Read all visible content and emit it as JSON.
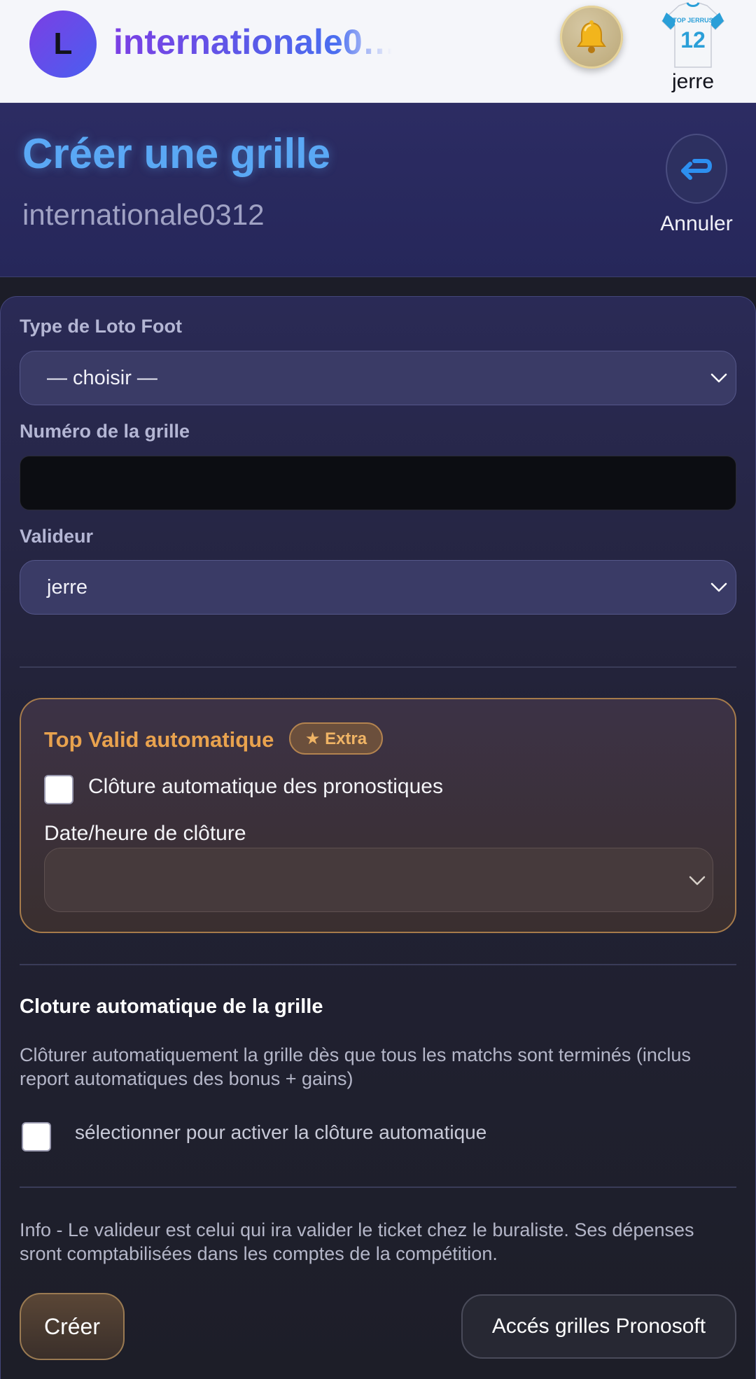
{
  "topbar": {
    "avatar_letter": "L",
    "app_title": "internationale0…",
    "user_name": "jerre",
    "jersey_text": "TOP JERRUS",
    "jersey_number": "12"
  },
  "header": {
    "title": "Créer une grille",
    "subtitle": "internationale0312",
    "cancel_label": "Annuler"
  },
  "form": {
    "type_label": "Type de Loto Foot",
    "type_value": "— choisir —",
    "number_label": "Numéro de la grille",
    "number_value": "",
    "validator_label": "Valideur",
    "validator_value": "jerre"
  },
  "top_valid": {
    "title": "Top Valid automatique",
    "badge": "★ Extra",
    "checkbox_label": "Clôture automatique des pronostiques",
    "checkbox_checked": false,
    "date_label": "Date/heure de clôture",
    "date_value": ""
  },
  "auto_close": {
    "title": "Cloture automatique de la grille",
    "description": "Clôturer automatiquement la grille dès que tous les matchs sont terminés (inclus report automatiques des bonus + gains)",
    "checkbox_label": "sélectionner pour activer la clôture automatique",
    "checkbox_checked": false
  },
  "info": {
    "text": "Info - Le valideur est celui qui ira valider le ticket chez le buraliste. Ses dépenses sront comptabilisées dans les comptes de la compétition."
  },
  "actions": {
    "create_label": "Créer",
    "pronosoft_label": "Accés grilles Pronosoft"
  },
  "colors": {
    "accent_blue": "#5aa8f5",
    "accent_orange": "#e8a24e",
    "brand_purple": "#7b3fe4"
  },
  "icons": {
    "bell": "bell-icon",
    "cancel": "return-arrow-icon",
    "chevron": "chevron-down-icon"
  }
}
